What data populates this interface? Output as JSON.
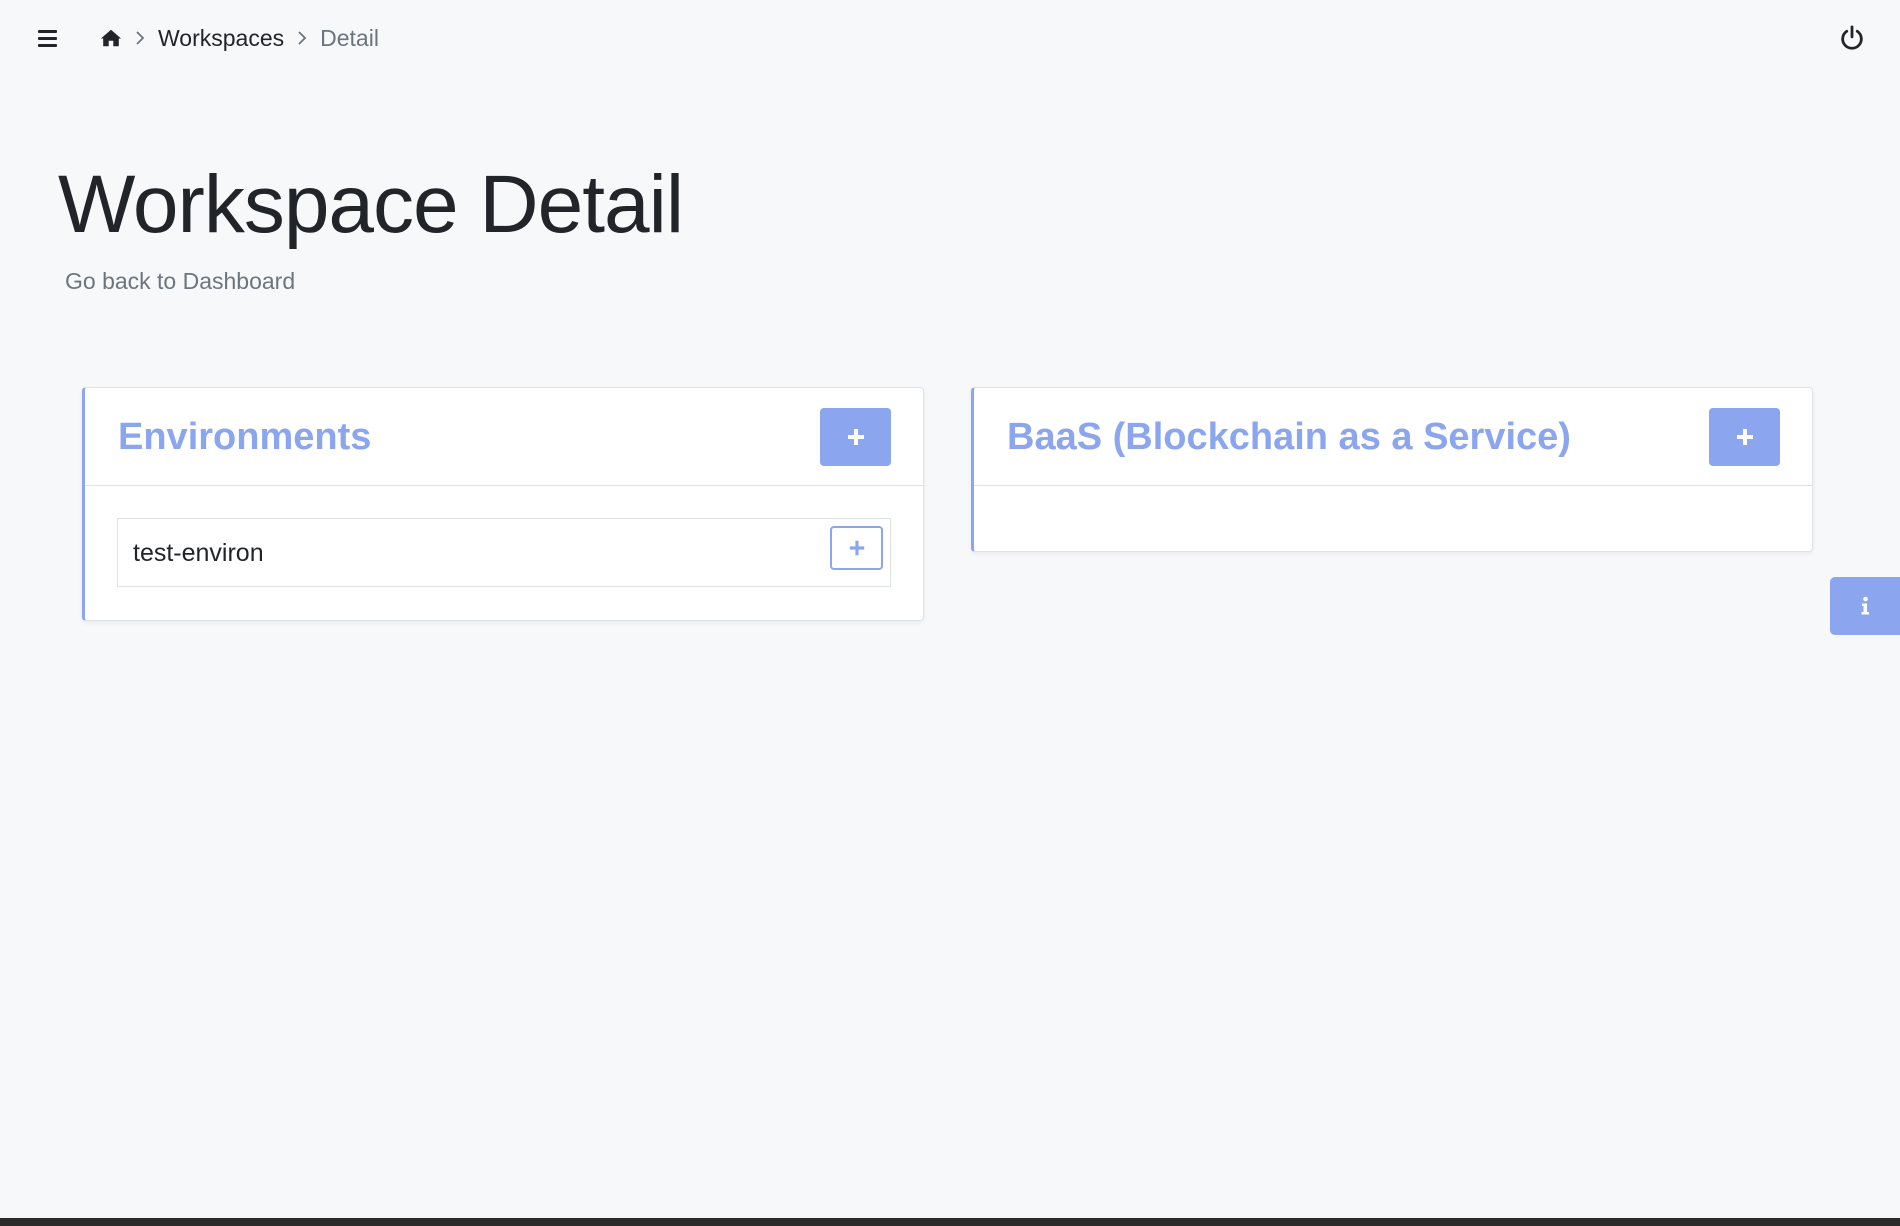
{
  "breadcrumb": {
    "home_icon": "home-icon",
    "items": [
      "Workspaces",
      "Detail"
    ]
  },
  "header": {
    "title": "Workspace Detail",
    "back_link": "Go back to Dashboard"
  },
  "cards": {
    "environments": {
      "title": "Environments",
      "items": [
        {
          "label": "test-environ"
        }
      ]
    },
    "baas": {
      "title": "BaaS (Blockchain as a Service)",
      "items": []
    }
  },
  "icons": {
    "menu": "hamburger-menu-icon",
    "power": "power-icon",
    "add": "plus-icon",
    "info": "info-icon"
  },
  "colors": {
    "accent": "#8ba5ef",
    "background": "#f7f8fa",
    "text": "#212529",
    "muted": "#6c757d"
  }
}
